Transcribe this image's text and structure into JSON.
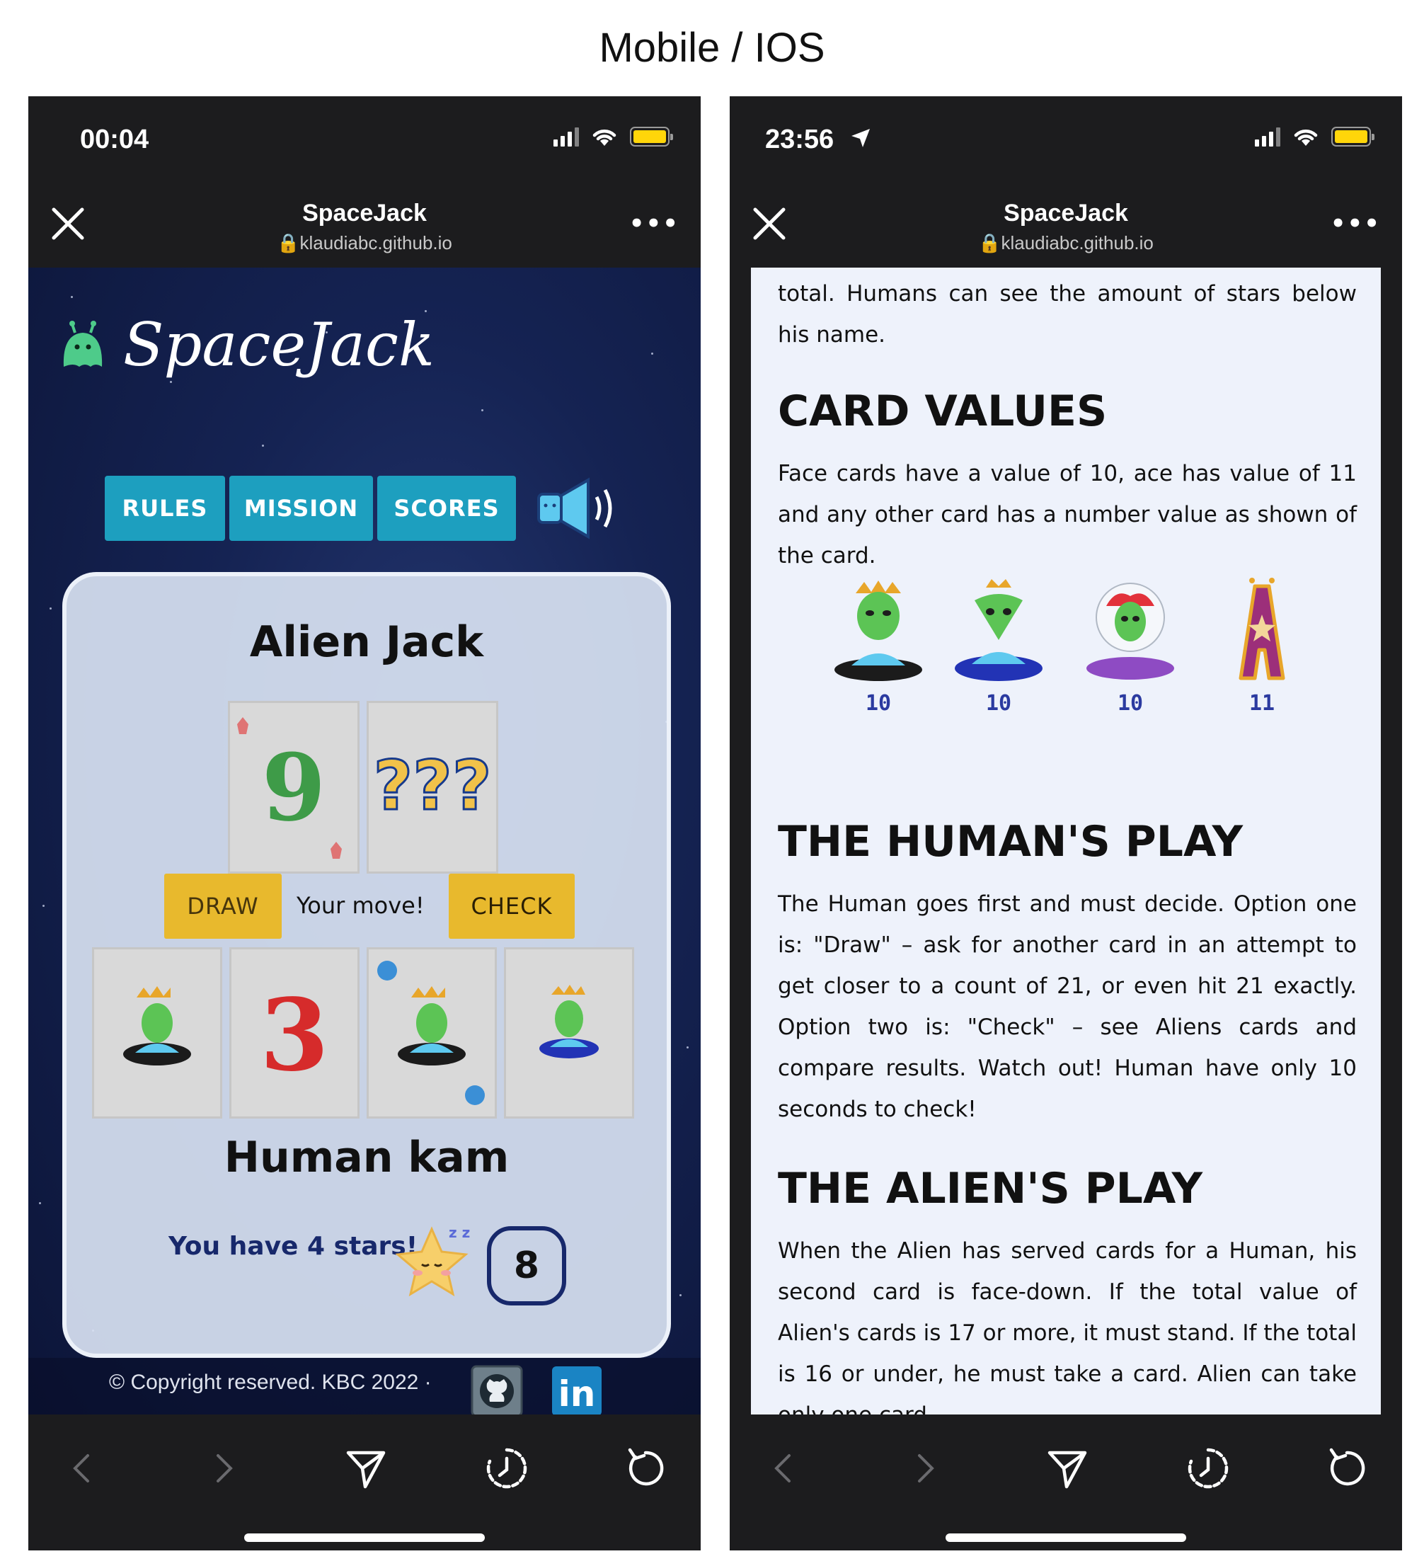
{
  "page_heading": "Mobile / IOS",
  "left_phone": {
    "status_time": "00:04",
    "browser": {
      "title": "SpaceJack",
      "url": "klaudiabc.github.io"
    },
    "app": {
      "logo_text": "SpaceJack",
      "nav": [
        "RULES",
        "MISSION",
        "SCORES"
      ],
      "alien_title": "Alien Jack",
      "draw_label": "DRAW",
      "check_label": "CHECK",
      "status_message": "Your move!",
      "human_name": "Human kam",
      "stars_message": "You have 4 stars!",
      "card_count": "8",
      "alien_cards": [
        {
          "value": "9"
        },
        {
          "value": "???"
        }
      ],
      "human_cards": [
        {
          "value": "alien"
        },
        {
          "value": "3"
        },
        {
          "value": "alien"
        },
        {
          "value": "alien"
        }
      ],
      "footer_text": "© Copyright reserved. KBC 2022 ·",
      "colors": {
        "nav_button": "#1d9fbf",
        "action_button": "#e8b92d",
        "accent_navy": "#17286b"
      }
    }
  },
  "right_phone": {
    "status_time": "23:56",
    "browser": {
      "title": "SpaceJack",
      "url": "klaudiabc.github.io"
    },
    "doc": {
      "intro_line": "total. Humans can see the amount of stars below his name.",
      "card_values": {
        "heading": "CARD VALUES",
        "text": "Face cards have a value of 10, ace has value of 11 and any other card has a number value as shown of the card.",
        "examples": [
          {
            "value": "10"
          },
          {
            "value": "10"
          },
          {
            "value": "10"
          },
          {
            "value": "11"
          }
        ]
      },
      "human_play": {
        "heading": "THE HUMAN'S PLAY",
        "text": "The Human goes first and must decide. Option one is: \"Draw\" – ask for another card in an attempt to get closer to a count of 21, or even hit 21 exactly. Option two is: \"Check\" – see Aliens cards and compare results. Watch out! Human have only 10 seconds to check!"
      },
      "alien_play": {
        "heading": "THE ALIEN'S PLAY",
        "text": "When the Alien has served cards for a Human, his second card is face-down. If the total value of Alien's cards is 17 or more, it must stand. If the total is 16 or under, he must take a card. Alien can take only one card."
      }
    }
  }
}
